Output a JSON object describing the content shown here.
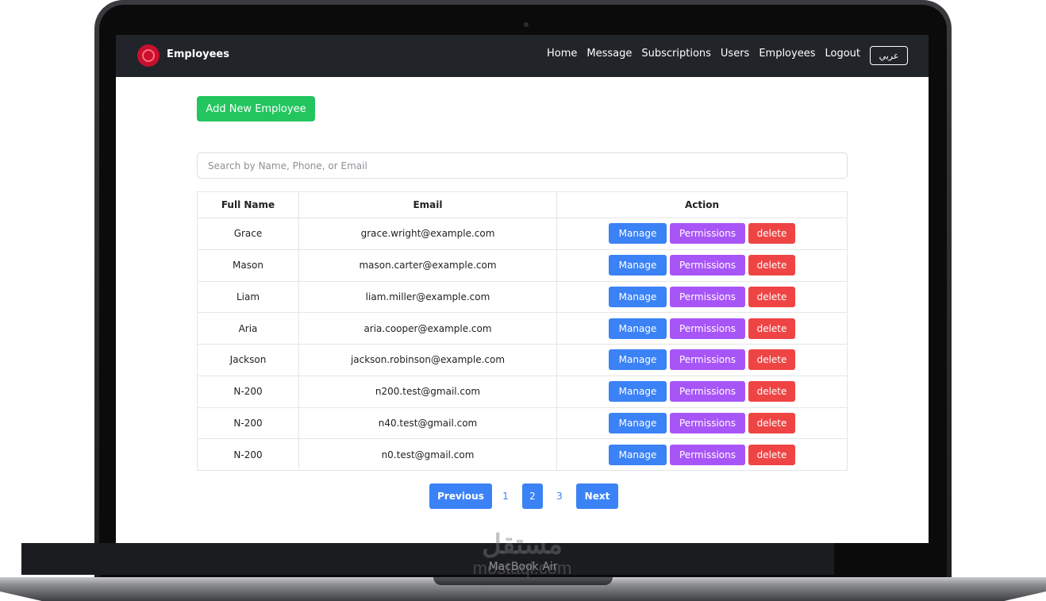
{
  "device": {
    "model_label": "MacBook Air"
  },
  "watermark": {
    "arabic": "مستقل",
    "latin": "mostaql.com"
  },
  "navbar": {
    "brand": "Employees",
    "links": [
      "Home",
      "Message",
      "Subscriptions",
      "Users",
      "Employees",
      "Logout"
    ],
    "language_button": "عربي"
  },
  "toolbar": {
    "add_label": "Add New Employee"
  },
  "search": {
    "placeholder": "Search by Name, Phone, or Email",
    "value": ""
  },
  "table": {
    "headers": [
      "Full Name",
      "Email",
      "Action"
    ],
    "rows": [
      {
        "name": "Grace",
        "email": "grace.wright@example.com"
      },
      {
        "name": "Mason",
        "email": "mason.carter@example.com"
      },
      {
        "name": "Liam",
        "email": "liam.miller@example.com"
      },
      {
        "name": "Aria",
        "email": "aria.cooper@example.com"
      },
      {
        "name": "Jackson",
        "email": "jackson.robinson@example.com"
      },
      {
        "name": "N-200",
        "email": "n200.test@gmail.com"
      },
      {
        "name": "N-200",
        "email": "n40.test@gmail.com"
      },
      {
        "name": "N-200",
        "email": "n0.test@gmail.com"
      }
    ],
    "action_labels": {
      "manage": "Manage",
      "permissions": "Permissions",
      "delete": "delete"
    }
  },
  "pagination": {
    "previous": "Previous",
    "pages": [
      "1",
      "2",
      "3"
    ],
    "current": "2",
    "next": "Next"
  },
  "colors": {
    "navbar": "#212529",
    "success": "#22c55e",
    "primary": "#3b82f6",
    "purple": "#a855f7",
    "danger": "#ef4444"
  }
}
